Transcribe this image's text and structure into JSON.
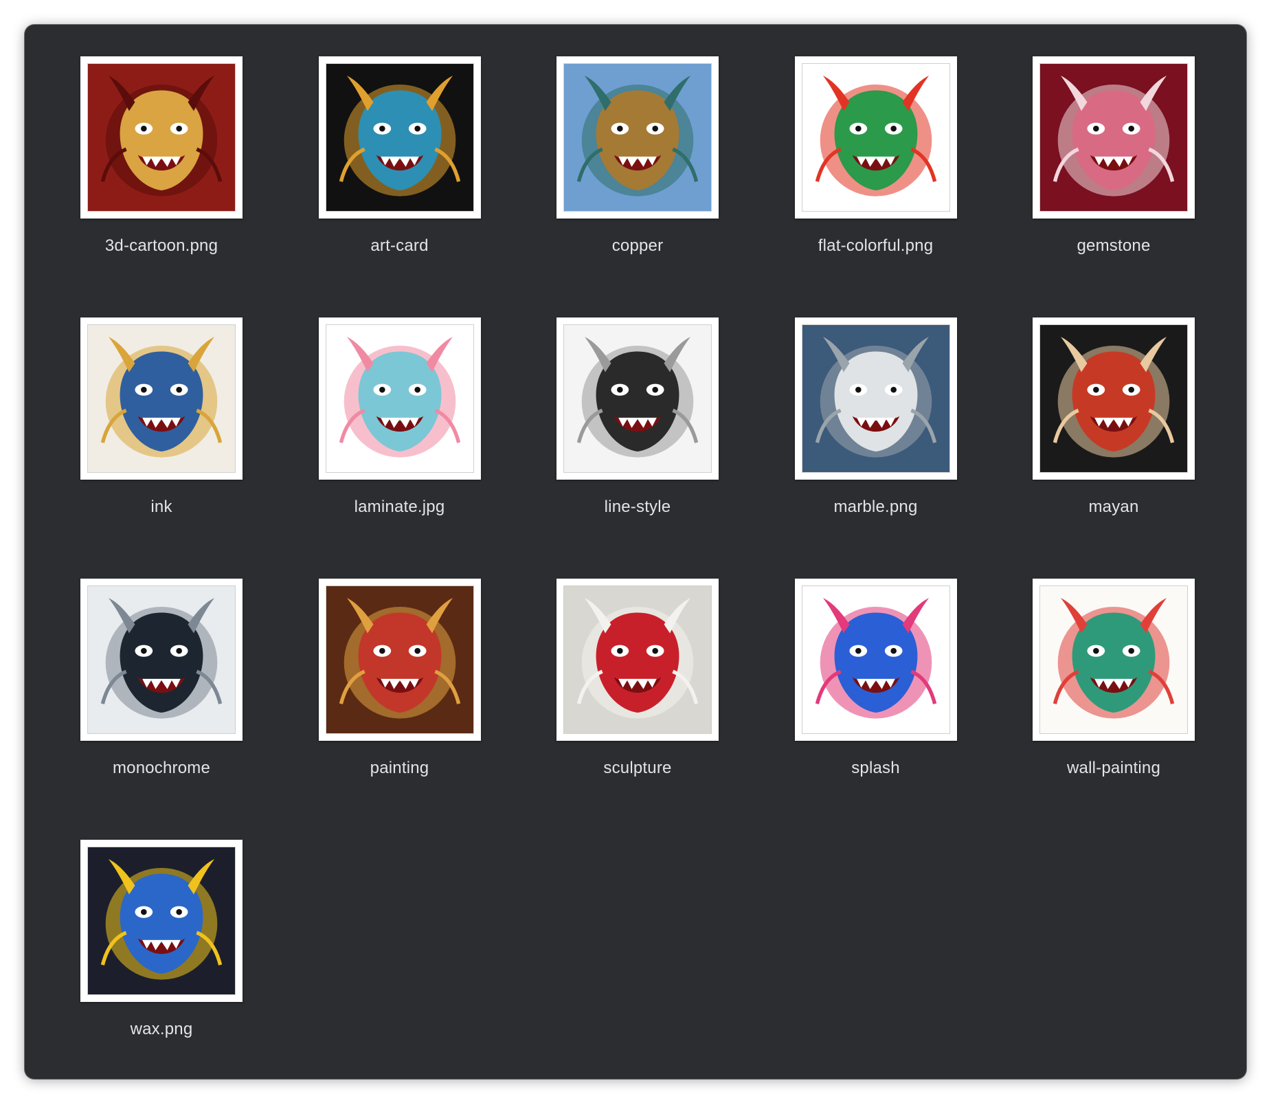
{
  "files": [
    {
      "name": "3d-cartoon.png",
      "icon": "red-gold-dragon-medallion-thumbnail",
      "bg": "#8e1c16",
      "accent": "#d9a441",
      "accent2": "#5a0d0b"
    },
    {
      "name": "art-card",
      "icon": "blue-gold-dragon-card-thumbnail",
      "bg": "#111111",
      "accent": "#2d8fb3",
      "accent2": "#e0a02e"
    },
    {
      "name": "copper",
      "icon": "bronze-teal-dragon-head-thumbnail",
      "bg": "#6f9fd1",
      "accent": "#a47a35",
      "accent2": "#2f6e6a"
    },
    {
      "name": "flat-colorful.png",
      "icon": "green-red-flat-dragon-thumbnail",
      "bg": "#ffffff",
      "accent": "#2b9a4a",
      "accent2": "#e23424"
    },
    {
      "name": "gemstone",
      "icon": "pink-gem-dragon-head-thumbnail",
      "bg": "#7a1020",
      "accent": "#d96a84",
      "accent2": "#f2d7dc"
    },
    {
      "name": "ink",
      "icon": "blue-ink-dragon-thumbnail",
      "bg": "#f1ede5",
      "accent": "#2f5f9e",
      "accent2": "#d9a53a"
    },
    {
      "name": "laminate.jpg",
      "icon": "pastel-dragon-mask-thumbnail",
      "bg": "#ffffff",
      "accent": "#7cc7d6",
      "accent2": "#f08aa3"
    },
    {
      "name": "line-style",
      "icon": "black-line-dragon-thumbnail",
      "bg": "#f4f4f4",
      "accent": "#2a2a2a",
      "accent2": "#9a9a9a"
    },
    {
      "name": "marble.png",
      "icon": "white-marble-dragon-clouds-thumbnail",
      "bg": "#3c5a7a",
      "accent": "#dfe3e6",
      "accent2": "#9aa4ab"
    },
    {
      "name": "mayan",
      "icon": "red-patterned-dragon-thumbnail",
      "bg": "#1a1a1a",
      "accent": "#c63a25",
      "accent2": "#e8c9a0"
    },
    {
      "name": "monochrome",
      "icon": "black-mountain-dragon-thumbnail",
      "bg": "#e9ecef",
      "accent": "#1d2630",
      "accent2": "#7d8894"
    },
    {
      "name": "painting",
      "icon": "red-demon-dragon-painting-thumbnail",
      "bg": "#5a2a14",
      "accent": "#c2372a",
      "accent2": "#e0a040"
    },
    {
      "name": "sculpture",
      "icon": "white-red-dragon-sculpture-thumbnail",
      "bg": "#d9d7d1",
      "accent": "#c8202a",
      "accent2": "#f4f2ee"
    },
    {
      "name": "splash",
      "icon": "colorful-splash-dragon-thumbnail",
      "bg": "#ffffff",
      "accent": "#2b5fd6",
      "accent2": "#e23a7a"
    },
    {
      "name": "wall-painting",
      "icon": "teal-red-coiled-dragon-thumbnail",
      "bg": "#fbfaf6",
      "accent": "#2f9a7a",
      "accent2": "#e0403a"
    },
    {
      "name": "wax.png",
      "icon": "blue-yellow-dragon-mask-thumbnail",
      "bg": "#1c1f2b",
      "accent": "#2a67c8",
      "accent2": "#f0c21e"
    }
  ]
}
